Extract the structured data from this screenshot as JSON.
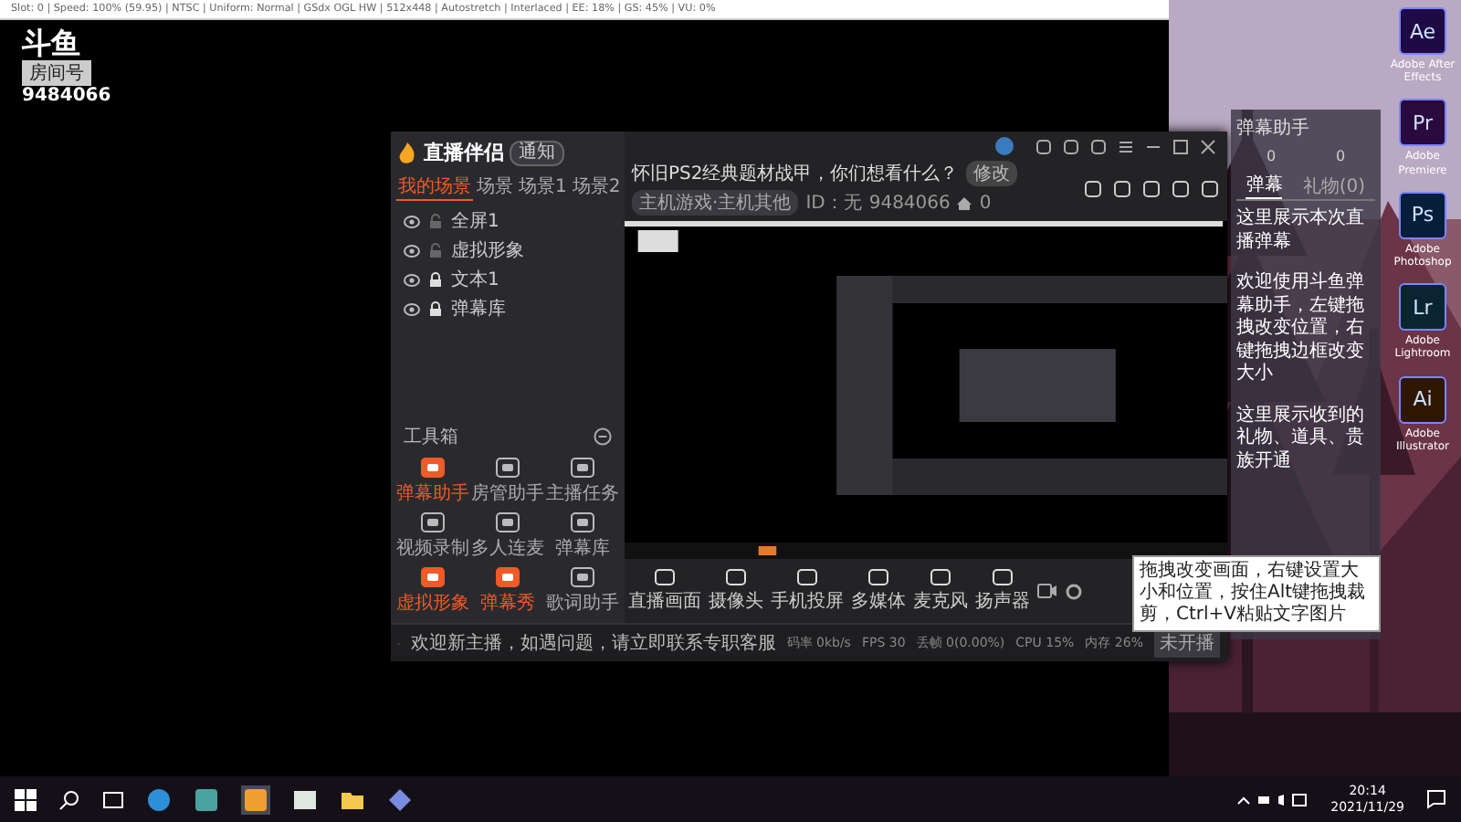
{
  "emulator_window": {
    "title": "Slot: 0 | Speed: 100% (59.95) | NTSC | Uniform: Normal | GSdx OGL HW | 512x448 | Autostretch | Interlaced | EE: 18% | GS: 45% | VU: 0%",
    "logo": "斗鱼",
    "room_label": "房间号",
    "room_number": "9484066"
  },
  "app": {
    "brand": "直播伴侣",
    "badge": "通知",
    "scene_tabs": [
      {
        "label": "我的场景",
        "selected": true
      },
      {
        "label": "场景",
        "selected": false
      },
      {
        "label": "场景1",
        "selected": false
      },
      {
        "label": "场景2",
        "selected": false
      }
    ],
    "sources": [
      {
        "name": "全屏1",
        "locked": false
      },
      {
        "name": "虚拟形象",
        "locked": false
      },
      {
        "name": "文本1",
        "locked": true
      },
      {
        "name": "弹幕库",
        "locked": true
      }
    ],
    "toolbox_title": "工具箱",
    "tools": [
      {
        "label": "弹幕助手",
        "active": true
      },
      {
        "label": "房管助手",
        "active": false
      },
      {
        "label": "主播任务",
        "active": false
      },
      {
        "label": "视频录制",
        "active": false
      },
      {
        "label": "多人连麦",
        "active": false
      },
      {
        "label": "弹幕库",
        "active": false
      },
      {
        "label": "虚拟形象",
        "active": true
      },
      {
        "label": "弹幕秀",
        "active": true
      },
      {
        "label": "歌词助手",
        "active": false
      }
    ],
    "stream_title": "怀旧PS2经典题材战甲，你们想看什么？",
    "edit_button": "修改",
    "category": "主机游戏·主机其他",
    "id_text": "ID：无",
    "room_id": "9484066",
    "likes": "0",
    "toolbar": [
      "直播画面",
      "摄像头",
      "手机投屏",
      "多媒体",
      "麦克风",
      "扬声器"
    ],
    "status_notice": "欢迎新主播，如遇问题，请立即联系专职客服",
    "stats": [
      "码率 0kb/s",
      "FPS 30",
      "丢帧 0(0.00%)",
      "CPU 15%",
      "内存 26%"
    ],
    "start_button": "未开播"
  },
  "assistant_panel": {
    "title": "弹幕助手",
    "counts": [
      "0",
      "0"
    ],
    "tabs": [
      {
        "label": "弹幕",
        "selected": true
      },
      {
        "label": "礼物(0)",
        "selected": false
      }
    ],
    "messages": [
      "这里展示本次直播弹幕",
      "欢迎使用斗鱼弹幕助手，左键拖拽改变位置，右键拖拽边框改变大小",
      "这里展示收到的礼物、道具、贵族开通"
    ]
  },
  "desktop_icons": [
    {
      "badge": "Ae",
      "label": "Adobe After Effects",
      "color": "#1f0a45"
    },
    {
      "badge": "Pr",
      "label": "Adobe Premiere",
      "color": "#2a0a3e"
    },
    {
      "badge": "Ps",
      "label": "Adobe Photoshop",
      "color": "#061e3a"
    },
    {
      "badge": "Lr",
      "label": "Adobe Lightroom",
      "color": "#0a2530"
    },
    {
      "badge": "Ai",
      "label": "Adobe Illustrator",
      "color": "#2f1600"
    }
  ],
  "tooltip": "拖拽改变画面，右键设置大小和位置，按住Alt键拖拽裁剪，Ctrl+V粘贴文字图片",
  "taskbar": {
    "time": "20:14",
    "date": "2021/11/29"
  }
}
